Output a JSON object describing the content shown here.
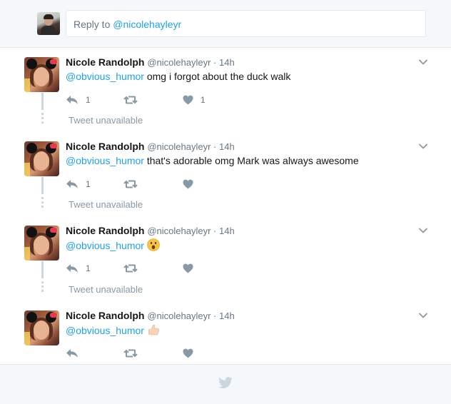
{
  "reply_box": {
    "prefix": "Reply to ",
    "mention": "@nicolehayleyr"
  },
  "unavailable_label": "Tweet unavailable",
  "tweets": [
    {
      "name": "Nicole Randolph",
      "handle": "@nicolehayleyr",
      "sep": " · ",
      "time": "14h",
      "mention": "@obvious_humor",
      "text": " omg i forgot about the duck walk",
      "emoji": "",
      "reply_count": "1",
      "retweet_count": "",
      "like_count": "1"
    },
    {
      "name": "Nicole Randolph",
      "handle": "@nicolehayleyr",
      "sep": " · ",
      "time": "14h",
      "mention": "@obvious_humor",
      "text": " that's adorable omg Mark was always awesome",
      "emoji": "",
      "reply_count": "1",
      "retweet_count": "",
      "like_count": ""
    },
    {
      "name": "Nicole Randolph",
      "handle": "@nicolehayleyr",
      "sep": " · ",
      "time": "14h",
      "mention": "@obvious_humor",
      "text": " ",
      "emoji": "surprised-face-emoji",
      "reply_count": "1",
      "retweet_count": "",
      "like_count": ""
    },
    {
      "name": "Nicole Randolph",
      "handle": "@nicolehayleyr",
      "sep": " · ",
      "time": "14h",
      "mention": "@obvious_humor",
      "text": " ",
      "emoji": "thumbs-up-emoji",
      "reply_count": "",
      "retweet_count": "",
      "like_count": ""
    }
  ],
  "icons": {
    "reply": "reply-icon",
    "retweet": "retweet-icon",
    "like": "heart-icon",
    "caret": "chevron-down-icon",
    "footer": "twitter-bird-icon"
  },
  "colors": {
    "accent": "#1da1f2",
    "muted": "#8899a6",
    "background": "#f5f8fa"
  }
}
